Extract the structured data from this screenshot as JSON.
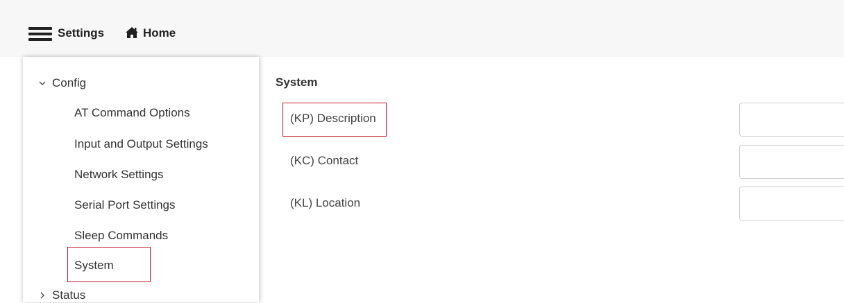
{
  "header": {
    "menu_icon": "hamburger-menu-icon",
    "settings_label": "Settings",
    "home_icon": "home-icon",
    "home_label": "Home"
  },
  "sidebar": {
    "config": {
      "label": "Config",
      "expanded": true,
      "icon": "chevron-down-icon"
    },
    "items": [
      {
        "label": "AT Command Options"
      },
      {
        "label": "Input and Output Settings"
      },
      {
        "label": "Network Settings"
      },
      {
        "label": "Serial Port Settings"
      },
      {
        "label": "Sleep Commands"
      },
      {
        "label": "System",
        "selected": true
      }
    ],
    "status": {
      "label": "Status",
      "expanded": false,
      "icon": "chevron-right-icon"
    }
  },
  "main": {
    "section_title": "System",
    "fields": [
      {
        "label": "(KP) Description",
        "value": "",
        "highlighted": true
      },
      {
        "label": "(KC) Contact",
        "value": ""
      },
      {
        "label": "(KL) Location",
        "value": ""
      }
    ]
  },
  "colors": {
    "highlight_border": "#c0182b",
    "header_bg": "#f7f7f7"
  }
}
